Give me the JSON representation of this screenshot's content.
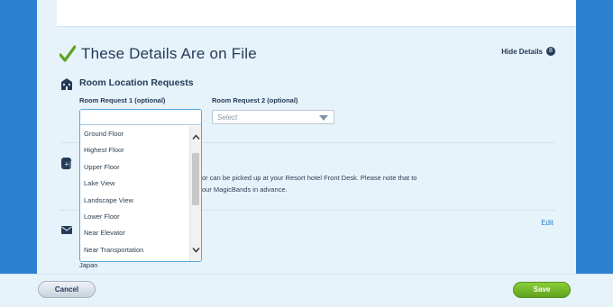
{
  "panel": {
    "title": "These Details Are on File",
    "hide_details_label": "Hide Details",
    "hide_details_toggle": "8"
  },
  "room_location": {
    "title": "Room Location Requests",
    "request1_label": "Room Request 1 (optional)",
    "request1_value": "",
    "request2_label": "Room Request 2 (optional)",
    "request2_placeholder": "Select",
    "dropdown_options": [
      "Ground Floor",
      "Highest Floor",
      "Upper Floor",
      "Lake View",
      "Landscape View",
      "Lower Floor",
      "Near Elevator",
      "Near Transportation"
    ]
  },
  "magicbands": {
    "line1": "or can be picked up at your Resort hotel Front Desk. Please note that to",
    "line2": "our MagicBands in advance."
  },
  "address": {
    "edit_label": "Edit",
    "country": "Japan"
  },
  "footer": {
    "cancel_label": "Cancel",
    "save_label": "Save"
  },
  "colors": {
    "page_background": "#2d7fd0",
    "panel_background": "#e6f3fb",
    "heading_text": "#253b56",
    "check_green": "#5fa21f",
    "link_blue": "#2d7fd0",
    "dropdown_focus_border": "#56a8dc"
  },
  "icons": {
    "check": "check-icon",
    "room": "building-icon",
    "magicband": "magicband-icon",
    "mail": "envelope-icon",
    "scroll_up": "chevron-up-icon",
    "scroll_down": "chevron-down-icon",
    "select_arrow": "caret-down-icon"
  }
}
